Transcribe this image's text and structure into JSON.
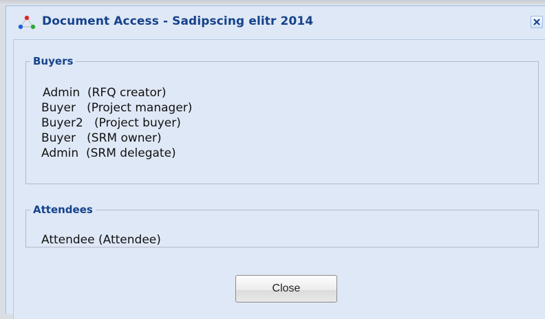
{
  "dialog": {
    "title": "Document Access - Sadipscing elitr 2014",
    "close_icon": "x-close-icon"
  },
  "buyers": {
    "legend": "Buyers",
    "rows": [
      "Admin  (RFQ creator)",
      "Buyer   (Project manager)",
      "Buyer2   (Project buyer)",
      "Buyer   (SRM owner)",
      "Admin  (SRM delegate)"
    ]
  },
  "attendees": {
    "legend": "Attendees",
    "rows": [
      "Attendee (Attendee)"
    ]
  },
  "footer": {
    "close_label": "Close"
  }
}
